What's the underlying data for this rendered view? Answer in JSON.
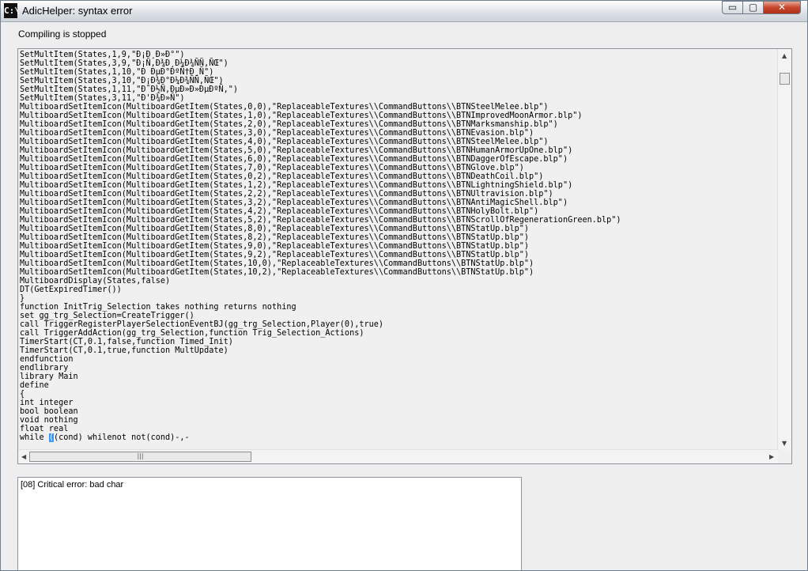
{
  "window": {
    "title": "AdicHelper: syntax error",
    "app_icon": "C:\\",
    "controls": {
      "minimize": "▭",
      "maximize": "▢",
      "close": "✕"
    }
  },
  "status": "Compiling is stopped",
  "code_lines": [
    "SetMultItem(States,1,9,\"Ð¡Ð¸Ð»Ð°\")",
    "SetMultItem(States,3,9,\"Ð¡Ñ‚Ð¾Ð¸Ð¼Ð¾ÑÑ‚ÑŒ\")",
    "SetMultItem(States,1,10,\"Ð ÐµÐ°ÐºÑ†Ð¸Ñ\")",
    "SetMultItem(States,3,10,\"Ð¡Ð¾Ð°Ð¼Ð¾ÑÑ‚ÑŒ\")",
    "SetMultItem(States,1,11,\"Ð˜Ð½Ñ‚ÐµÐ»Ð»ÐµÐºÑ‚\")",
    "SetMultItem(States,3,11,\"Ð'Ð¾Ð»Ñ\")",
    "MultiboardSetItemIcon(MultiboardGetItem(States,0,0),\"ReplaceableTextures\\\\CommandButtons\\\\BTNSteelMelee.blp\")",
    "MultiboardSetItemIcon(MultiboardGetItem(States,1,0),\"ReplaceableTextures\\\\CommandButtons\\\\BTNImprovedMoonArmor.blp\")",
    "MultiboardSetItemIcon(MultiboardGetItem(States,2,0),\"ReplaceableTextures\\\\CommandButtons\\\\BTNMarksmanship.blp\")",
    "MultiboardSetItemIcon(MultiboardGetItem(States,3,0),\"ReplaceableTextures\\\\CommandButtons\\\\BTNEvasion.blp\")",
    "MultiboardSetItemIcon(MultiboardGetItem(States,4,0),\"ReplaceableTextures\\\\CommandButtons\\\\BTNSteelMelee.blp\")",
    "MultiboardSetItemIcon(MultiboardGetItem(States,5,0),\"ReplaceableTextures\\\\CommandButtons\\\\BTNHumanArmorUpOne.blp\")",
    "MultiboardSetItemIcon(MultiboardGetItem(States,6,0),\"ReplaceableTextures\\\\CommandButtons\\\\BTNDaggerOfEscape.blp\")",
    "MultiboardSetItemIcon(MultiboardGetItem(States,7,0),\"ReplaceableTextures\\\\CommandButtons\\\\BTNGlove.blp\")",
    "MultiboardSetItemIcon(MultiboardGetItem(States,0,2),\"ReplaceableTextures\\\\CommandButtons\\\\BTNDeathCoil.blp\")",
    "MultiboardSetItemIcon(MultiboardGetItem(States,1,2),\"ReplaceableTextures\\\\CommandButtons\\\\BTNLightningShield.blp\")",
    "MultiboardSetItemIcon(MultiboardGetItem(States,2,2),\"ReplaceableTextures\\\\CommandButtons\\\\BTNUltravision.blp\")",
    "MultiboardSetItemIcon(MultiboardGetItem(States,3,2),\"ReplaceableTextures\\\\CommandButtons\\\\BTNAntiMagicShell.blp\")",
    "MultiboardSetItemIcon(MultiboardGetItem(States,4,2),\"ReplaceableTextures\\\\CommandButtons\\\\BTNHolyBolt.blp\")",
    "MultiboardSetItemIcon(MultiboardGetItem(States,5,2),\"ReplaceableTextures\\\\CommandButtons\\\\BTNScrollOfRegenerationGreen.blp\")",
    "MultiboardSetItemIcon(MultiboardGetItem(States,8,0),\"ReplaceableTextures\\\\CommandButtons\\\\BTNStatUp.blp\")",
    "MultiboardSetItemIcon(MultiboardGetItem(States,8,2),\"ReplaceableTextures\\\\CommandButtons\\\\BTNStatUp.blp\")",
    "MultiboardSetItemIcon(MultiboardGetItem(States,9,0),\"ReplaceableTextures\\\\CommandButtons\\\\BTNStatUp.blp\")",
    "MultiboardSetItemIcon(MultiboardGetItem(States,9,2),\"ReplaceableTextures\\\\CommandButtons\\\\BTNStatUp.blp\")",
    "MultiboardSetItemIcon(MultiboardGetItem(States,10,0),\"ReplaceableTextures\\\\CommandButtons\\\\BTNStatUp.blp\")",
    "MultiboardSetItemIcon(MultiboardGetItem(States,10,2),\"ReplaceableTextures\\\\CommandButtons\\\\BTNStatUp.blp\")",
    "MultiboardDisplay(States,false)",
    "DT(GetExpiredTimer())",
    "}",
    "function InitTrig_Selection takes nothing returns nothing",
    "set gg_trg_Selection=CreateTrigger()",
    "call TriggerRegisterPlayerSelectionEventBJ(gg_trg_Selection,Player(0),true)",
    "call TriggerAddAction(gg_trg_Selection,function Trig_Selection_Actions)",
    "TimerStart(CT,0.1,false,function Timed_Init)",
    "TimerStart(CT,0.1,true,function MultUpdate)",
    "endfunction",
    "endlibrary",
    "library Main",
    "define",
    "{",
    "int integer",
    "bool boolean",
    "void nothing",
    "float real"
  ],
  "last_line": {
    "before": "while ",
    "selected": "(",
    "after": "(cond) whilenot not(cond)-,-"
  },
  "scrollbar": {
    "up": "▲",
    "down": "▼",
    "left": "◀",
    "right": "▶",
    "grip": "|||"
  },
  "error_message": "[08] Critical error: bad char"
}
